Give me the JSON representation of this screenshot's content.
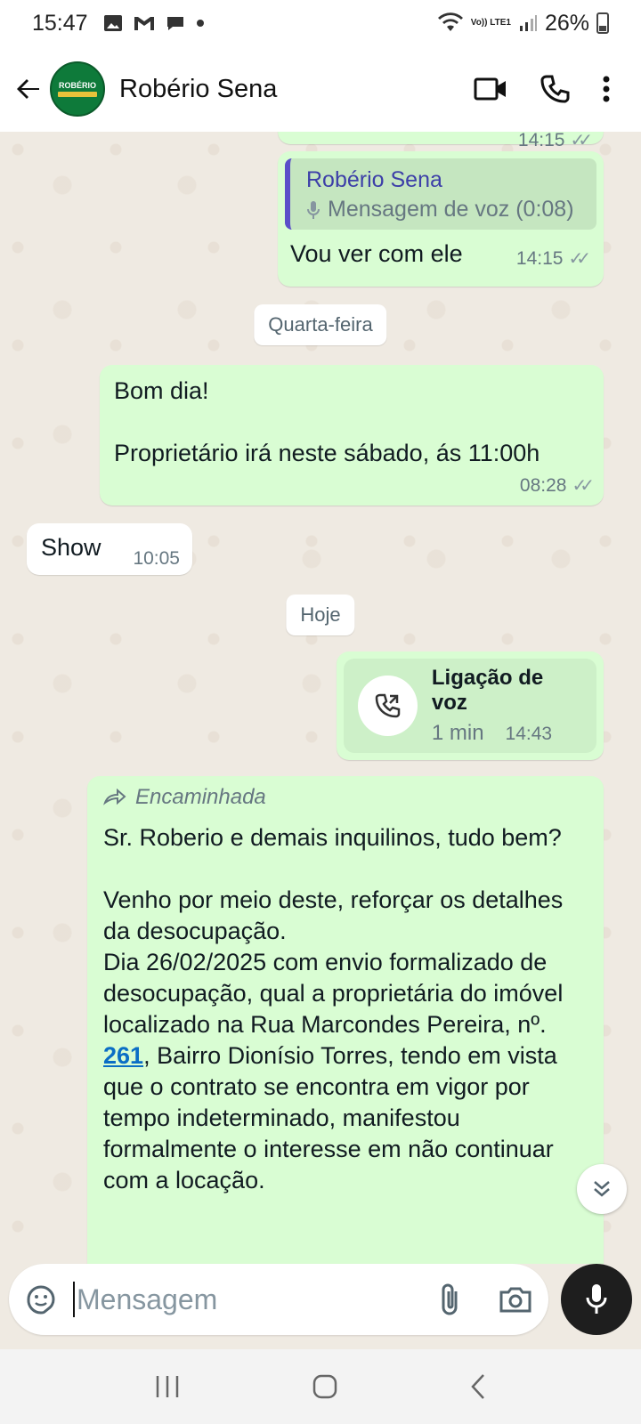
{
  "status_bar": {
    "time": "15:47",
    "battery": "26%",
    "network": "Vo)) LTE1",
    "icons": [
      "gallery-icon",
      "gmail-icon",
      "chat-bubble-icon",
      "dot-icon",
      "wifi-icon",
      "signal-icon",
      "battery-icon"
    ]
  },
  "header": {
    "contact_name": "Robério Sena",
    "avatar_text": "ROBÉRIO",
    "avatar_subtext": "TEMPLATE"
  },
  "messages": {
    "m0": {
      "time": "14:15"
    },
    "m1": {
      "quote_author": "Robério Sena",
      "quote_body": "Mensagem de voz (0:08)",
      "text": "Vou ver com ele",
      "time": "14:15"
    },
    "chip1": "Quarta-feira",
    "m2": {
      "line1": "Bom dia!",
      "line2": "Proprietário irá neste sábado, ás 11:00h",
      "time": "08:28"
    },
    "m3": {
      "text": "Show",
      "time": "10:05"
    },
    "chip2": "Hoje",
    "m4": {
      "call_title": "Ligação de voz",
      "call_duration": "1 min",
      "time": "14:43"
    },
    "m5": {
      "forwarded_label": "Encaminhada",
      "p1": "Sr. Roberio e demais inquilinos, tudo bem?",
      "p2a": "Venho por meio deste, reforçar os detalhes da desocupação.",
      "p2b": "Dia 26/02/2025 com envio formalizado de desocupação,  qual a  proprietária do imóvel localizado na Rua Marcondes Pereira, nº. ",
      "link": "261",
      "p2c": ", Bairro Dionísio Torres,  tendo em vista que o contrato se encontra em vigor por tempo indeterminado, manifestou formalmente o interesse em não continuar com a locação."
    }
  },
  "composer": {
    "placeholder": "Mensagem"
  },
  "colors": {
    "outgoing": "#d9fdd3",
    "incoming": "#ffffff",
    "background": "#efeae2",
    "accent": "#0b6ec5"
  }
}
